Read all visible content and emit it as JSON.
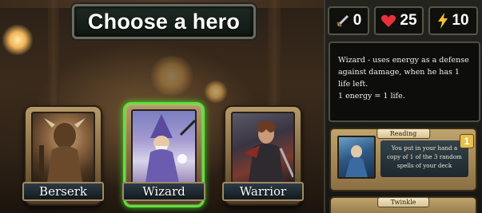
{
  "title": "Choose a hero",
  "heroes": [
    {
      "name": "Berserk",
      "selected": false
    },
    {
      "name": "Wizard",
      "selected": true
    },
    {
      "name": "Warrior",
      "selected": false
    }
  ],
  "stats": {
    "attack": {
      "icon": "sword-icon",
      "value": "0"
    },
    "health": {
      "icon": "heart-icon",
      "value": "25"
    },
    "energy": {
      "icon": "lightning-icon",
      "value": "10"
    }
  },
  "description": {
    "line1": "Wizard - uses energy as a defense against damage, when he has 1 life left.",
    "line2": "1 energy = 1 life."
  },
  "skills": [
    {
      "title": "Reading",
      "cost": "1",
      "text": "You put in your hand a copy of 1 of the 3 random spells of your deck"
    },
    {
      "title": "Twinkle"
    }
  ],
  "colors": {
    "selected_glow": "#62e03c",
    "heart": "#e8303a",
    "lightning": "#f2c230"
  }
}
